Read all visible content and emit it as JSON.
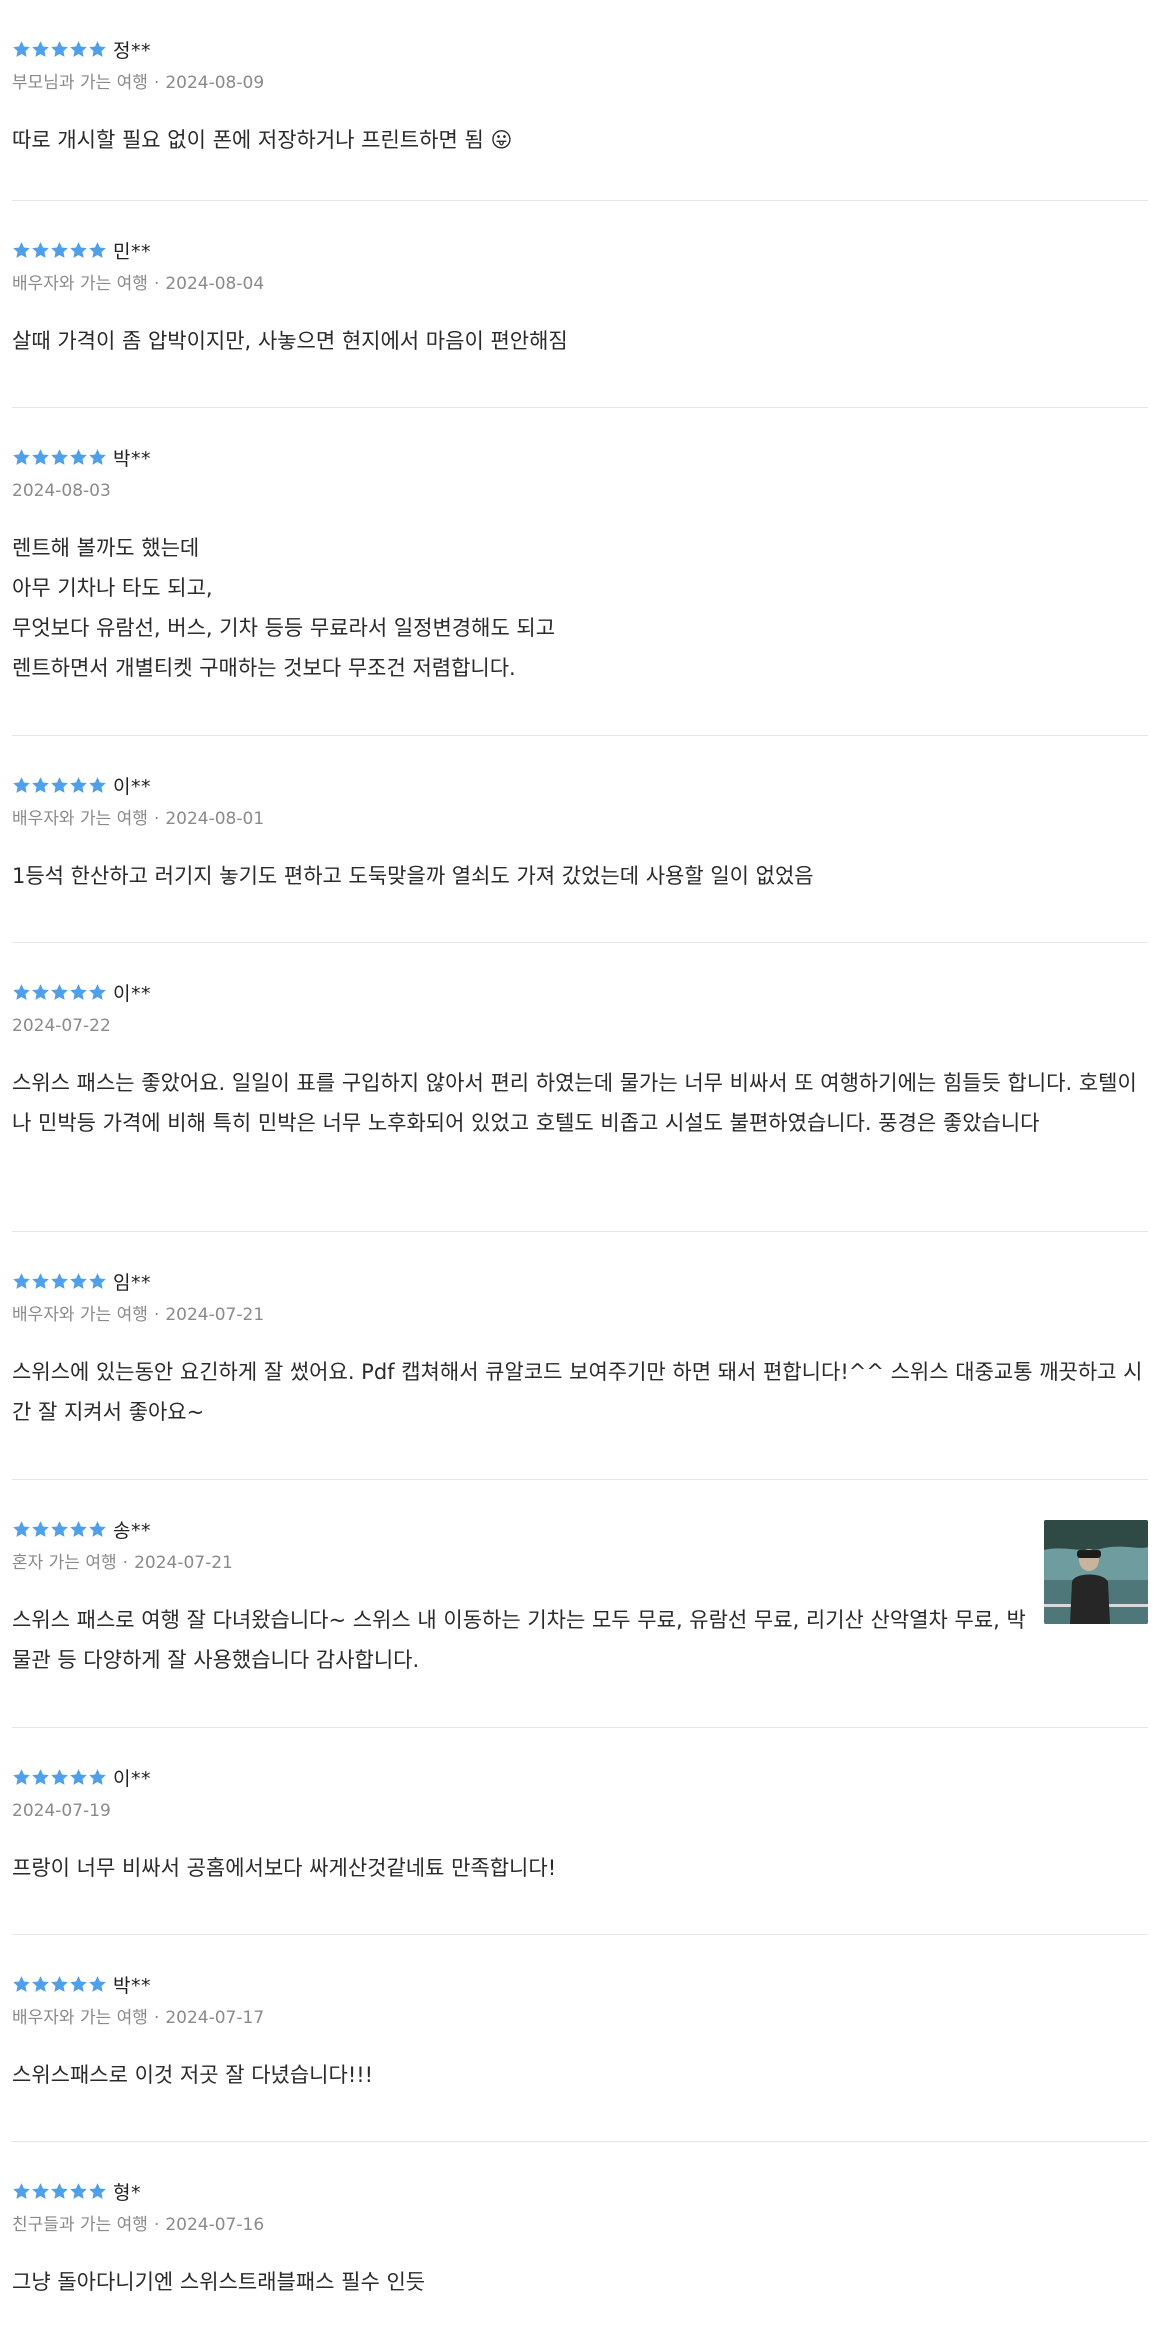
{
  "colors": {
    "star": "#4fa0e8",
    "meta": "#8a8a8a",
    "divider": "#e6e6e6"
  },
  "reviews": [
    {
      "rating": 5,
      "name": "정**",
      "companion": "부모님과 가는 여행",
      "date": "2024-08-09",
      "text": "따로 개시할 필요 없이 폰에 저장하거나 프린트하면 됨 😛",
      "has_photo": false
    },
    {
      "rating": 5,
      "name": "민**",
      "companion": "배우자와 가는 여행",
      "date": "2024-08-04",
      "text": "살때 가격이 좀 압박이지만, 사놓으면 현지에서 마음이 편안해짐",
      "has_photo": false
    },
    {
      "rating": 5,
      "name": "박**",
      "companion": "",
      "date": "2024-08-03",
      "text": "렌트해 볼까도 했는데\n아무 기차나 타도 되고,\n무엇보다 유람선, 버스, 기차 등등 무료라서 일정변경해도 되고\n렌트하면서 개별티켓 구매하는 것보다 무조건 저렴합니다.",
      "has_photo": false
    },
    {
      "rating": 5,
      "name": "이**",
      "companion": "배우자와 가는 여행",
      "date": "2024-08-01",
      "text": "1등석 한산하고 러기지 놓기도 편하고 도둑맞을까 열쇠도 가져 갔었는데 사용할 일이 없었음",
      "has_photo": false
    },
    {
      "rating": 5,
      "name": "이**",
      "companion": "",
      "date": "2024-07-22",
      "text": "스위스 패스는 좋았어요. 일일이 표를 구입하지 않아서 편리 하였는데 물가는 너무 비싸서 또 여행하기에는 힘들듯 합니다. 호텔이나 민박등 가격에 비해 특히 민박은 너무 노후화되어 있었고 호텔도 비좁고 시설도 불편하였습니다. 풍경은 좋았습니다",
      "has_photo": false
    },
    {
      "rating": 5,
      "name": "임**",
      "companion": "배우자와 가는 여행",
      "date": "2024-07-21",
      "text": "스위스에 있는동안 요긴하게 잘 썼어요. Pdf 캡쳐해서 큐알코드 보여주기만 하면 돼서 편합니다!^^ 스위스 대중교통 깨끗하고 시간 잘 지켜서 좋아요~",
      "has_photo": false
    },
    {
      "rating": 5,
      "name": "송**",
      "companion": "혼자 가는 여행",
      "date": "2024-07-21",
      "text": "스위스 패스로 여행 잘 다녀왔습니다~ 스위스 내 이동하는 기차는 모두 무료, 유람선 무료, 리기산 산악열차 무료, 박물관 등 다양하게 잘 사용했습니다 감사합니다.",
      "has_photo": true
    },
    {
      "rating": 5,
      "name": "이**",
      "companion": "",
      "date": "2024-07-19",
      "text": "프랑이 너무 비싸서 공홈에서보다 싸게산것같네툐 만족합니다!",
      "has_photo": false
    },
    {
      "rating": 5,
      "name": "박**",
      "companion": "배우자와 가는 여행",
      "date": "2024-07-17",
      "text": "스위스패스로 이것 저곳 잘 다녔습니다!!!",
      "has_photo": false
    },
    {
      "rating": 5,
      "name": "형*",
      "companion": "친구들과 가는 여행",
      "date": "2024-07-16",
      "text": "그냥 돌아다니기엔 스위스트래블패스 필수 인듯",
      "has_photo": false
    }
  ]
}
